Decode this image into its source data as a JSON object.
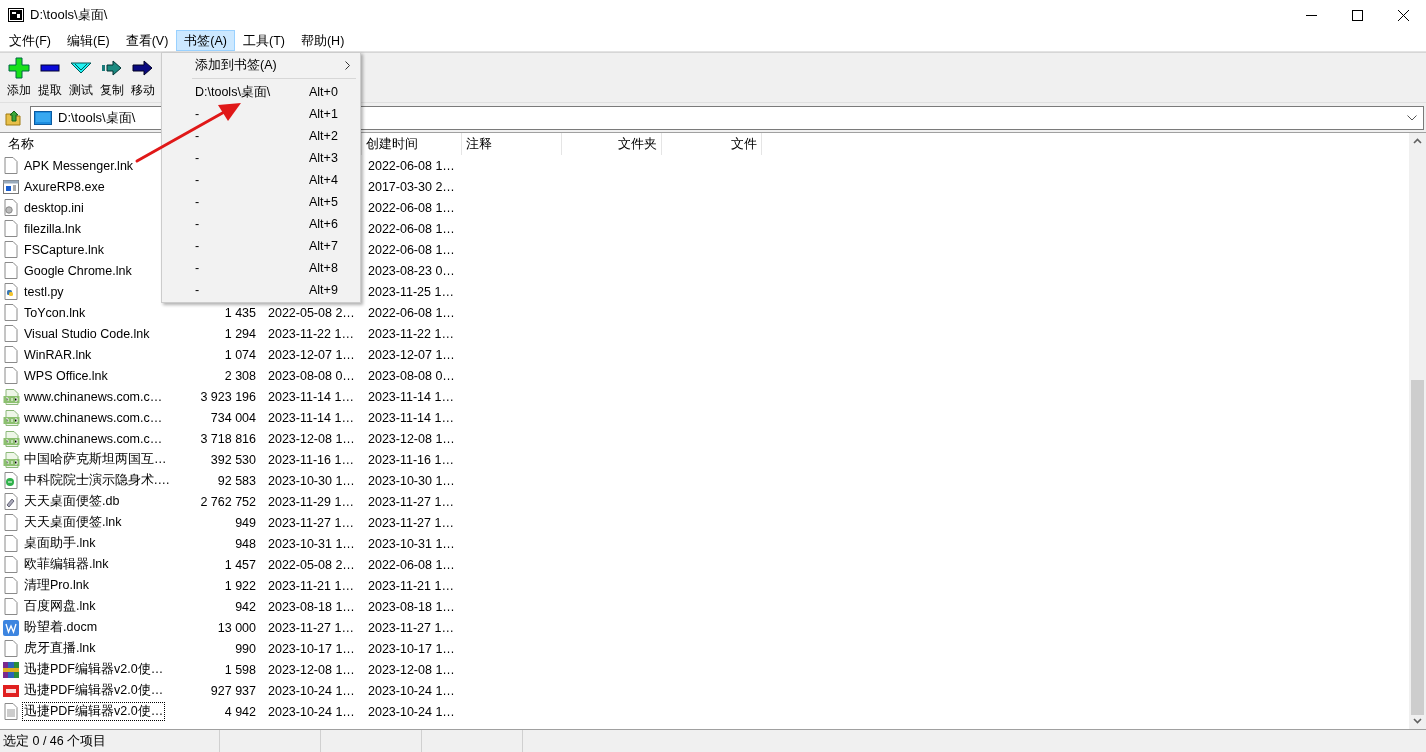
{
  "window": {
    "title": "D:\\tools\\桌面\\"
  },
  "menu_bar": [
    {
      "label": "文件(F)",
      "selected": false
    },
    {
      "label": "编辑(E)",
      "selected": false
    },
    {
      "label": "查看(V)",
      "selected": false
    },
    {
      "label": "书签(A)",
      "selected": true
    },
    {
      "label": "工具(T)",
      "selected": false
    },
    {
      "label": "帮助(H)",
      "selected": false
    }
  ],
  "toolbar": [
    {
      "kind": "add",
      "label": "添加"
    },
    {
      "kind": "extract",
      "label": "提取"
    },
    {
      "kind": "test",
      "label": "测试"
    },
    {
      "kind": "copy",
      "label": "复制"
    },
    {
      "kind": "move",
      "label": "移动"
    }
  ],
  "address_bar": {
    "value": "D:\\tools\\桌面\\"
  },
  "table": {
    "columns": {
      "name": "名称",
      "created": "创建时间",
      "comment": "注释",
      "folders": "文件夹",
      "files": "文件"
    },
    "rows": [
      {
        "kind": "lnk",
        "name": "APK Messenger.lnk",
        "created": "2022-06-08 1…",
        "focused": false
      },
      {
        "kind": "exe",
        "name": "AxureRP8.exe",
        "created": "2017-03-30 2…",
        "focused": false
      },
      {
        "kind": "ini",
        "name": "desktop.ini",
        "created": "2022-06-08 1…",
        "focused": false
      },
      {
        "kind": "lnk",
        "name": "filezilla.lnk",
        "created": "2022-06-08 1…",
        "focused": false
      },
      {
        "kind": "lnk",
        "name": "FSCapture.lnk",
        "created": "2022-06-08 1…",
        "focused": false
      },
      {
        "kind": "lnk",
        "name": "Google Chrome.lnk",
        "created": "2023-08-23 0…",
        "focused": false
      },
      {
        "kind": "py",
        "name": "testl.py",
        "created": "2023-11-25 1…",
        "focused": false
      },
      {
        "kind": "lnk",
        "name": "ToYcon.lnk",
        "size": "1 435",
        "modified": "2022-05-08 2…",
        "created": "2022-06-08 1…",
        "focused": false
      },
      {
        "kind": "lnk",
        "name": "Visual Studio Code.lnk",
        "size": "1 294",
        "modified": "2023-11-22 1…",
        "created": "2023-11-22 1…",
        "focused": false
      },
      {
        "kind": "lnk",
        "name": "WinRAR.lnk",
        "size": "1 074",
        "modified": "2023-12-07 1…",
        "created": "2023-12-07 1…",
        "focused": false
      },
      {
        "kind": "lnk",
        "name": "WPS Office.lnk",
        "size": "2 308",
        "modified": "2023-08-08 0…",
        "created": "2023-08-08 0…",
        "focused": false
      },
      {
        "kind": "png",
        "name": "www.chinanews.com.c…",
        "size": "3 923 196",
        "modified": "2023-11-14 1…",
        "created": "2023-11-14 1…",
        "focused": false
      },
      {
        "kind": "png",
        "name": "www.chinanews.com.c…",
        "size": "734 004",
        "modified": "2023-11-14 1…",
        "created": "2023-11-14 1…",
        "focused": false
      },
      {
        "kind": "png",
        "name": "www.chinanews.com.c…",
        "size": "3 718 816",
        "modified": "2023-12-08 1…",
        "created": "2023-12-08 1…",
        "focused": false
      },
      {
        "kind": "png",
        "name": "中国哈萨克斯坦两国互…",
        "size": "392 530",
        "modified": "2023-11-16 1…",
        "created": "2023-11-16 1…",
        "focused": false
      },
      {
        "kind": "html",
        "name": "中科院院士演示隐身术.…",
        "size": "92 583",
        "modified": "2023-10-30 1…",
        "created": "2023-10-30 1…",
        "focused": false
      },
      {
        "kind": "db",
        "name": "天天桌面便签.db",
        "size": "2 762 752",
        "modified": "2023-11-29 1…",
        "created": "2023-11-27 1…",
        "focused": false
      },
      {
        "kind": "lnk",
        "name": "天天桌面便签.lnk",
        "size": "949",
        "modified": "2023-11-27 1…",
        "created": "2023-11-27 1…",
        "focused": false
      },
      {
        "kind": "lnk",
        "name": "桌面助手.lnk",
        "size": "948",
        "modified": "2023-10-31 1…",
        "created": "2023-10-31 1…",
        "focused": false
      },
      {
        "kind": "lnk",
        "name": "欧菲编辑器.lnk",
        "size": "1 457",
        "modified": "2022-05-08 2…",
        "created": "2022-06-08 1…",
        "focused": false
      },
      {
        "kind": "lnk",
        "name": "清理Pro.lnk",
        "size": "1 922",
        "modified": "2023-11-21 1…",
        "created": "2023-11-21 1…",
        "focused": false
      },
      {
        "kind": "lnk",
        "name": "百度网盘.lnk",
        "size": "942",
        "modified": "2023-08-18 1…",
        "created": "2023-08-18 1…",
        "focused": false
      },
      {
        "kind": "docm",
        "name": "盼望着.docm",
        "size": "13 000",
        "modified": "2023-11-27 1…",
        "created": "2023-11-27 1…",
        "focused": false
      },
      {
        "kind": "lnk",
        "name": "虎牙直播.lnk",
        "size": "990",
        "modified": "2023-10-17 1…",
        "created": "2023-10-17 1…",
        "focused": false
      },
      {
        "kind": "rar",
        "name": "迅捷PDF编辑器v2.0使…",
        "size": "1 598",
        "modified": "2023-12-08 1…",
        "created": "2023-12-08 1…",
        "focused": false
      },
      {
        "kind": "pdf",
        "name": "迅捷PDF编辑器v2.0使…",
        "size": "927 937",
        "modified": "2023-10-24 1…",
        "created": "2023-10-24 1…",
        "focused": false
      },
      {
        "kind": "txt",
        "name": "迅捷PDF编辑器v2.0使…",
        "size": "4 942",
        "modified": "2023-10-24 1…",
        "created": "2023-10-24 1…",
        "focused": true
      }
    ]
  },
  "bookmark_menu": {
    "items": [
      {
        "kind": "submenu",
        "label": "添加到书签(A)"
      },
      {
        "kind": "separator"
      },
      {
        "kind": "bookmark",
        "label": "D:\\tools\\桌面\\",
        "shortcut": "Alt+0"
      },
      {
        "kind": "bookmark",
        "label": "-",
        "shortcut": "Alt+1"
      },
      {
        "kind": "bookmark",
        "label": "-",
        "shortcut": "Alt+2"
      },
      {
        "kind": "bookmark",
        "label": "-",
        "shortcut": "Alt+3"
      },
      {
        "kind": "bookmark",
        "label": "-",
        "shortcut": "Alt+4"
      },
      {
        "kind": "bookmark",
        "label": "-",
        "shortcut": "Alt+5"
      },
      {
        "kind": "bookmark",
        "label": "-",
        "shortcut": "Alt+6"
      },
      {
        "kind": "bookmark",
        "label": "-",
        "shortcut": "Alt+7"
      },
      {
        "kind": "bookmark",
        "label": "-",
        "shortcut": "Alt+8"
      },
      {
        "kind": "bookmark",
        "label": "-",
        "shortcut": "Alt+9"
      }
    ]
  },
  "status_bar": {
    "text": "选定 0 / 46 个项目"
  }
}
